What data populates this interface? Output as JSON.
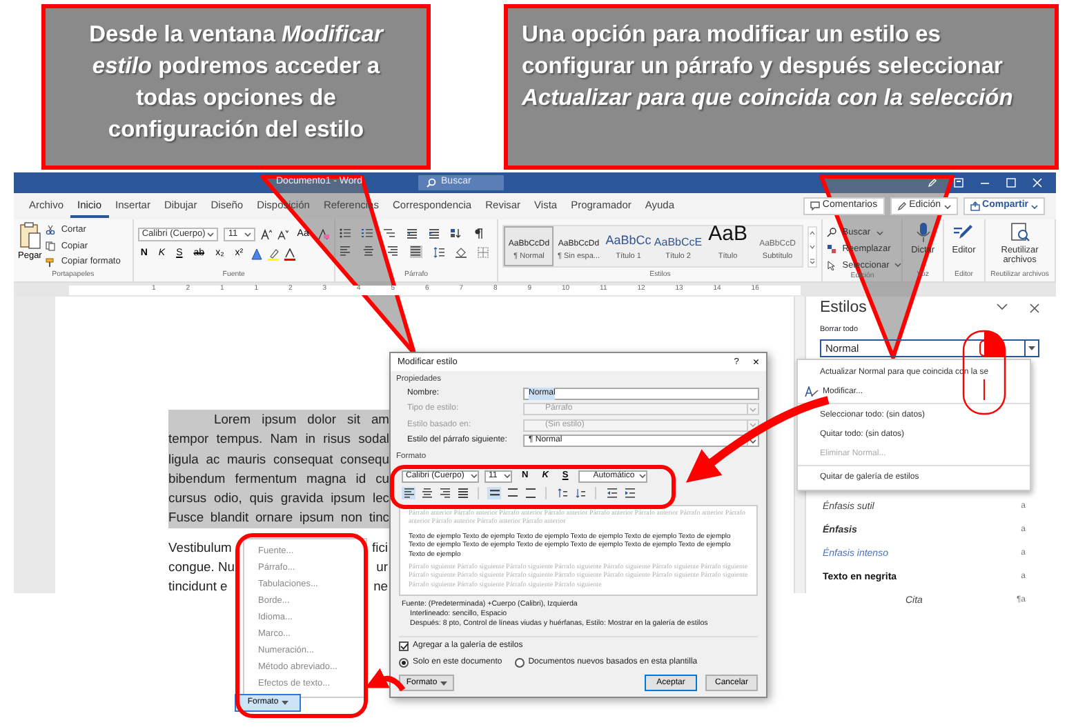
{
  "callouts": [
    {
      "text": "Desde la ventana *Modificar estilo* podremos acceder a todas opciones de configuración del estilo"
    },
    {
      "text": "Una opción para modificar un estilo es configurar un párrafo y después seleccionar *Actualizar para que coincida con la selección*"
    }
  ],
  "window": {
    "title": "Documento1 - Word",
    "search": {
      "placeholder": "Buscar"
    }
  },
  "ribbon": {
    "tabs": [
      {
        "label": "Archivo",
        "selected": false
      },
      {
        "label": "Inicio",
        "selected": true
      },
      {
        "label": "Insertar",
        "selected": false
      },
      {
        "label": "Dibujar",
        "selected": false
      },
      {
        "label": "Diseño",
        "selected": false
      },
      {
        "label": "Disposición",
        "selected": false
      },
      {
        "label": "Referencias",
        "selected": false
      },
      {
        "label": "Correspondencia",
        "selected": false
      },
      {
        "label": "Revisar",
        "selected": false
      },
      {
        "label": "Vista",
        "selected": false
      },
      {
        "label": "Programador",
        "selected": false
      },
      {
        "label": "Ayuda",
        "selected": false
      }
    ],
    "actions": [
      {
        "label": "Comentarios",
        "kind": "comments"
      },
      {
        "label": "Edición",
        "kind": "edit"
      },
      {
        "label": "Compartir",
        "kind": "share"
      }
    ],
    "clipboard": {
      "paste": "Pegar",
      "items": [
        {
          "label": "Cortar",
          "kind": "cut"
        },
        {
          "label": "Copiar",
          "kind": "copy"
        },
        {
          "label": "Copiar formato",
          "kind": "brush"
        }
      ],
      "label": "Portapapeles"
    },
    "font": {
      "name": "Calibri (Cuerpo)",
      "size": "11",
      "case": "Aa",
      "buttons": [
        "N",
        "K",
        "S",
        "ab",
        "x₂",
        "x²"
      ],
      "label": "Fuente"
    },
    "paragraph": {
      "alignments": [
        {
          "kind": "left",
          "selected": false
        },
        {
          "kind": "center",
          "selected": false
        },
        {
          "kind": "right",
          "selected": false
        },
        {
          "kind": "justify",
          "selected": true
        }
      ],
      "label": "Párrafo"
    },
    "styles": {
      "items": [
        {
          "preview": "AaBbCcDd",
          "name": "¶ Normal",
          "kind": "normal",
          "selected": true
        },
        {
          "preview": "AaBbCcDd",
          "name": "¶ Sin espa...",
          "kind": "normal",
          "selected": false
        },
        {
          "preview": "AaBbCc",
          "name": "Título 1",
          "kind": "heading1",
          "selected": false
        },
        {
          "preview": "AaBbCcE",
          "name": "Título 2",
          "kind": "heading2",
          "selected": false
        },
        {
          "preview": "AaB",
          "name": "Título",
          "kind": "title",
          "selected": false
        },
        {
          "preview": "AaBbCcD",
          "name": "Subtítulo",
          "kind": "subtitle",
          "selected": false
        }
      ],
      "label": "Estilos"
    },
    "editing": {
      "items": [
        {
          "label": "Buscar",
          "kind": "find"
        },
        {
          "label": "Reemplazar",
          "kind": "replace"
        },
        {
          "label": "Seleccionar",
          "kind": "select"
        }
      ],
      "label": "Edición"
    },
    "voice": {
      "button": "Dictar",
      "label": "Voz"
    },
    "editor": {
      "button": "Editor",
      "label": "Editor"
    },
    "reuse": {
      "button": "Reutilizar archivos",
      "label": "Reutilizar archivos"
    }
  },
  "ruler": [
    "1",
    "2",
    "1",
    "1",
    "2",
    "3",
    "4",
    "5",
    "6",
    "7",
    "8",
    "9",
    "10",
    "11",
    "12",
    "13",
    "14",
    "16"
  ],
  "document": {
    "paragraphs": [
      {
        "selected": true,
        "lines": [
          {
            "text": "Lorem ipsum dolor sit am",
            "indent": true
          },
          {
            "text": "tempor tempus. Nam in risus sodal",
            "indent": false
          },
          {
            "text": "ligula ac mauris consequat consequ",
            "indent": false
          },
          {
            "text": "bibendum fermentum magna id cu",
            "indent": false
          },
          {
            "text": "cursus odio, quis gravida ipsum lec",
            "indent": false
          },
          {
            "text": "Fusce blandit ornare ipsum non tinc",
            "indent": false
          }
        ]
      },
      {
        "selected": false,
        "lines": [
          {
            "text": "Vestibulum",
            "tail": "fici",
            "indent": false
          },
          {
            "text": "congue. Nu",
            "tail": "ur",
            "indent": false
          },
          {
            "text": "tincidunt e",
            "tail": "ne",
            "indent": false
          }
        ]
      }
    ]
  },
  "styles_pane": {
    "title": "Estilos",
    "clear": "Borrar todo",
    "current": "Normal",
    "items": [
      {
        "name": "Énfasis sutil",
        "kind": "subtle",
        "mark": "a"
      },
      {
        "name": "Énfasis",
        "kind": "emphasis",
        "mark": "a"
      },
      {
        "name": "Énfasis intenso",
        "kind": "intense",
        "mark": "a"
      },
      {
        "name": "Texto en negrita",
        "kind": "strong",
        "mark": "a"
      },
      {
        "name": "Cita",
        "kind": "quote",
        "mark": "¶a"
      }
    ]
  },
  "styles_menu": {
    "groups": [
      {
        "items": [
          {
            "label": "Actualizar Normal para que coincida con la se",
            "kind": "plain",
            "disabled": false
          },
          {
            "label": "Modificar...",
            "kind": "modify",
            "disabled": false
          }
        ]
      },
      {
        "items": [
          {
            "label": "Seleccionar todo: (sin datos)",
            "kind": "plain",
            "disabled": false
          },
          {
            "label": "Quitar todo: (sin datos)",
            "kind": "plain",
            "disabled": false
          },
          {
            "label": "Eliminar Normal...",
            "kind": "plain",
            "disabled": true
          }
        ]
      },
      {
        "items": [
          {
            "label": "Quitar de galería de estilos",
            "kind": "plain",
            "disabled": false
          }
        ]
      }
    ]
  },
  "dialog": {
    "title": "Modificar estilo",
    "help": "?",
    "close": "×",
    "properties_label": "Propiedades",
    "fields": [
      {
        "label": "Nombre:",
        "value": "Normal",
        "disabled": false,
        "dropdown": false,
        "highlighted": true
      },
      {
        "label": "Tipo de estilo:",
        "value": "Párrafo",
        "disabled": true,
        "dropdown": true,
        "highlighted": false
      },
      {
        "label": "Estilo basado en:",
        "value": "(Sin estilo)",
        "disabled": true,
        "dropdown": true,
        "highlighted": false
      },
      {
        "label": "Estilo del párrafo siguiente:",
        "value": "¶ Normal",
        "disabled": false,
        "dropdown": true,
        "highlighted": false
      }
    ],
    "format_label": "Formato",
    "font": "Calibri (Cuerpo)",
    "size": "11",
    "font_buttons": [
      "N",
      "K",
      "S"
    ],
    "font_tone": "Automático",
    "tools": [
      {
        "kind": "left",
        "selected": true
      },
      {
        "kind": "center",
        "selected": false
      },
      {
        "kind": "right",
        "selected": false
      },
      {
        "kind": "justify",
        "selected": false
      },
      {
        "kind": "single",
        "selected": true
      },
      {
        "kind": "onehalf",
        "selected": false
      },
      {
        "kind": "double",
        "selected": false
      },
      {
        "kind": "space-up",
        "selected": false
      },
      {
        "kind": "space-down",
        "selected": false
      },
      {
        "kind": "indent-less",
        "selected": false
      },
      {
        "kind": "indent-more",
        "selected": false
      }
    ],
    "preview": {
      "previous": "Párrafo anterior Párrafo anterior Párrafo anterior Párrafo anterior Párrafo anterior Párrafo anterior Párrafo anterior Párrafo anterior Párrafo anterior Párrafo anterior Párrafo anterior",
      "sample": "Texto de ejemplo Texto de ejemplo Texto de ejemplo Texto de ejemplo Texto de ejemplo Texto de ejemplo Texto de ejemplo Texto de ejemplo Texto de ejemplo Texto de ejemplo Texto de ejemplo Texto de ejemplo Texto de ejemplo",
      "next": "Párrafo siguiente Párrafo siguiente Párrafo siguiente Párrafo siguiente Párrafo siguiente Párrafo siguiente Párrafo siguiente Párrafo siguiente Párrafo siguiente Párrafo siguiente Párrafo siguiente Párrafo siguiente Párrafo siguiente Párrafo siguiente Párrafo siguiente Párrafo siguiente Párrafo siguiente Párrafo siguiente"
    },
    "description": [
      "Fuente: (Predeterminada) +Cuerpo (Calibri), Izquierda",
      "Interlineado:  sencillo, Espacio",
      "Después:  8 pto, Control de líneas viudas y huérfanas, Estilo: Mostrar en la galería de estilos"
    ],
    "add_to_gallery": {
      "label": "Agregar a la galería de estilos",
      "checked": true
    },
    "scope": [
      {
        "label": "Solo en este documento",
        "selected": true
      },
      {
        "label": "Documentos nuevos basados en esta plantilla",
        "selected": false
      }
    ],
    "buttons": [
      {
        "label": "Formato",
        "kind": "menu"
      },
      {
        "label": "Aceptar",
        "kind": "default"
      },
      {
        "label": "Cancelar",
        "kind": "plain"
      }
    ]
  },
  "format_menu": {
    "items": [
      "Fuente...",
      "Párrafo...",
      "Tabulaciones...",
      "Borde...",
      "Idioma...",
      "Marco...",
      "Numeración...",
      "Método abreviado...",
      "Efectos de texto..."
    ],
    "button": "Formato"
  }
}
